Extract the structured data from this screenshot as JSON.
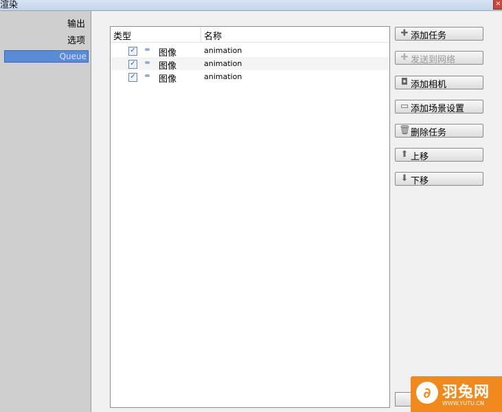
{
  "window": {
    "title": "渲染",
    "close_label": "×"
  },
  "sidebar": {
    "items": [
      {
        "label": "输出",
        "selected": false
      },
      {
        "label": "选项",
        "selected": false
      },
      {
        "label": "Queue",
        "selected": true
      }
    ]
  },
  "queue": {
    "columns": {
      "type": "类型",
      "name": "名称"
    },
    "rows": [
      {
        "checked": true,
        "check_mark": "✓",
        "icon": "image-icon",
        "type": "图像",
        "name": "animation"
      },
      {
        "checked": true,
        "check_mark": "✓",
        "icon": "image-icon",
        "type": "图像",
        "name": "animation"
      },
      {
        "checked": true,
        "check_mark": "✓",
        "icon": "image-icon",
        "type": "图像",
        "name": "animation"
      }
    ]
  },
  "actions": {
    "add_task": {
      "label": "添加任务",
      "icon": "✚"
    },
    "send_network": {
      "label": "发送到网络",
      "icon": "✚",
      "disabled": true
    },
    "add_camera": {
      "label": "添加相机",
      "icon": "◘"
    },
    "add_scene": {
      "label": "添加场景设置",
      "icon": "▭"
    },
    "delete_task": {
      "label": "删除任务",
      "icon": "🗑"
    },
    "move_up": {
      "label": "上移",
      "icon": "⬆"
    },
    "move_down": {
      "label": "下移",
      "icon": "⬇"
    }
  },
  "watermark": {
    "brand": "羽兔网",
    "url": "WWW.YUTU.CN",
    "logo_glyph": "∂"
  },
  "colors": {
    "accent": "#5b8ad6",
    "watermark": "#f08a1e"
  }
}
